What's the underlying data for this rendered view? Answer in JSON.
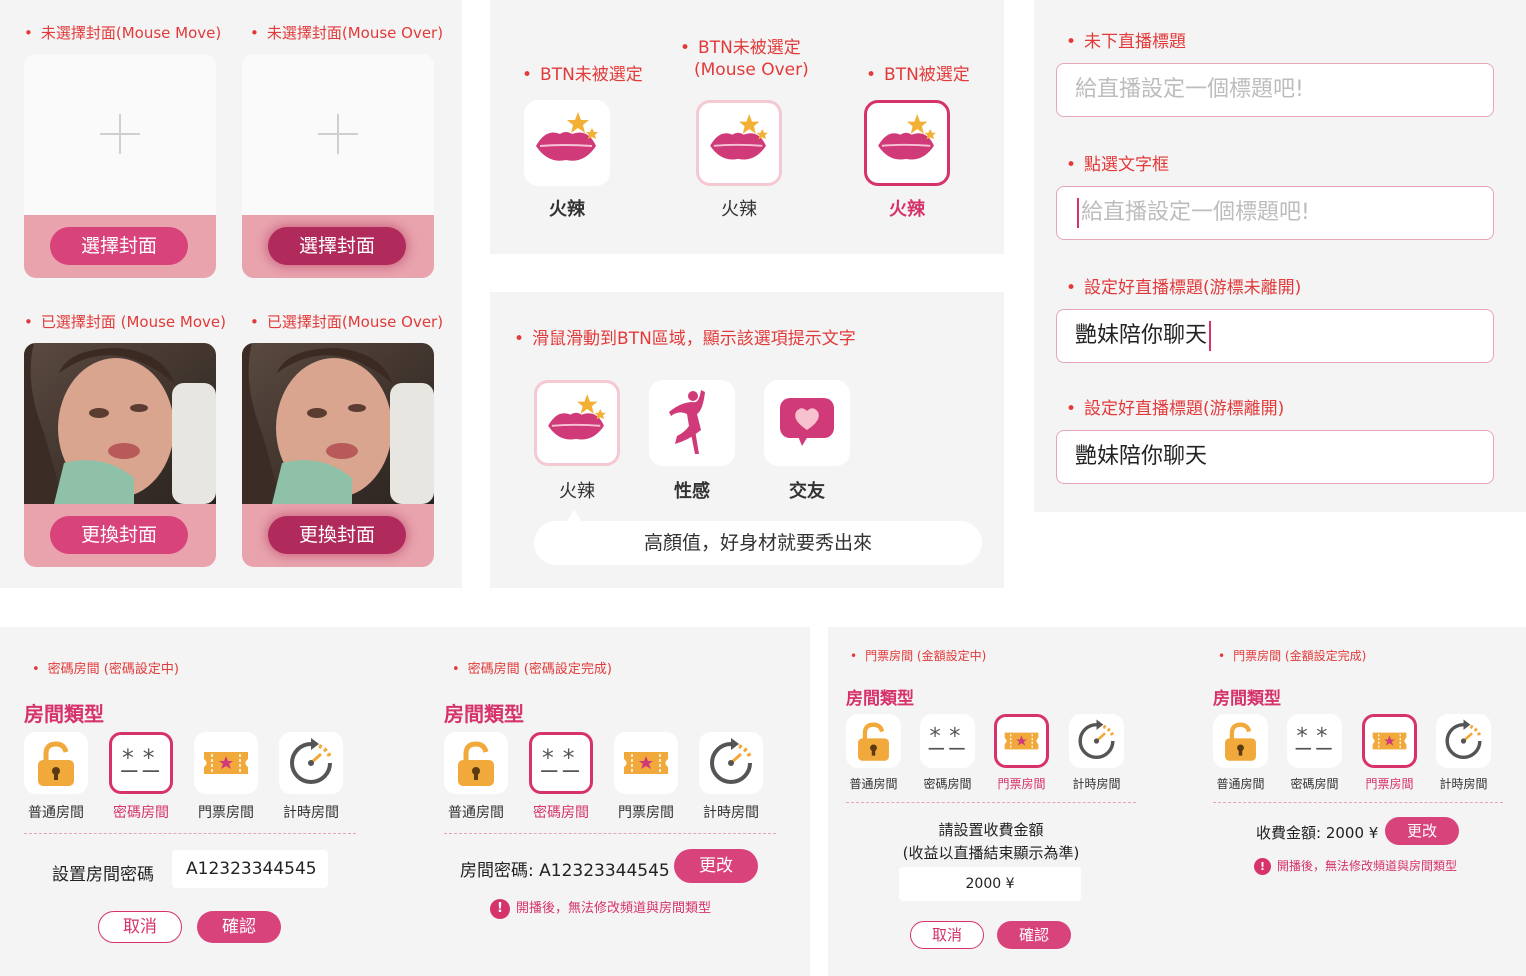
{
  "covers": {
    "unselected_move_note": "未選擇封面(Mouse Move)",
    "unselected_over_note": "未選擇封面(Mouse Over)",
    "selected_move_note": "已選擇封面 (Mouse Move)",
    "selected_over_note": "已選擇封面(Mouse Over)",
    "choose_label": "選擇封面",
    "change_label": "更換封面"
  },
  "tags_states": {
    "unselected_note": "BTN未被選定",
    "hover_note_line1": "BTN未被選定",
    "hover_note_line2": "(Mouse Over)",
    "selected_note": "BTN被選定",
    "tag_label": "火辣"
  },
  "tags_hint": {
    "note": "滑鼠滑動到BTN區域，顯示該選項提示文字",
    "items": [
      {
        "label": "火辣",
        "icon": "kiss-lips-icon"
      },
      {
        "label": "性感",
        "icon": "dancer-icon"
      },
      {
        "label": "交友",
        "icon": "heart-chat-icon"
      }
    ],
    "tooltip": "高顏值，好身材就要秀出來"
  },
  "title_fields": {
    "empty_note": "未下直播標題",
    "focus_note": "點選文字框",
    "typed_note": "設定好直播標題(游標未離開)",
    "done_note": "設定好直播標題(游標離開)",
    "placeholder": "給直播設定一個標題吧!",
    "value": "艷妹陪你聊天"
  },
  "room_types": {
    "title": "房間類型",
    "items": [
      "普通房間",
      "密碼房間",
      "門票房間",
      "計時房間"
    ]
  },
  "password_setting": {
    "note": "密碼房間 (密碼設定中)",
    "label": "設置房間密碼",
    "value": "A12323344545",
    "cancel": "取消",
    "confirm": "確認"
  },
  "password_done": {
    "note": "密碼房間 (密碼設定完成)",
    "text": "房間密碼: A12323344545",
    "change": "更改",
    "warning": "開播後，無法修改頻道與房間類型"
  },
  "ticket_setting": {
    "note": "門票房間 (金額設定中)",
    "line1": "請設置收費金額",
    "line2": "(收益以直播結束顯示為準)",
    "value": "2000 ¥",
    "cancel": "取消",
    "confirm": "確認"
  },
  "ticket_done": {
    "note": "門票房間 (金額設定完成)",
    "text": "收費金額: 2000 ¥",
    "change": "更改",
    "warning": "開播後，無法修改頻道與房間類型"
  },
  "colors": {
    "accent": "#d6336c",
    "note_red": "#e23a3a",
    "panel_bg": "#f4f4f4",
    "card_pink": "#e8a3ad"
  }
}
